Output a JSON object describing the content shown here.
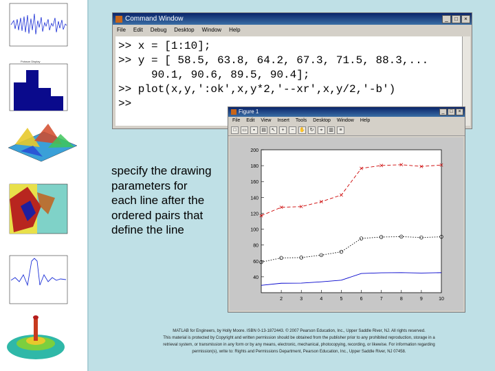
{
  "command_window": {
    "title": "Command Window",
    "menu": [
      "File",
      "Edit",
      "Debug",
      "Desktop",
      "Window",
      "Help"
    ],
    "lines": [
      ">> x = [1:10];",
      ">> y = [ 58.5, 63.8, 64.2, 67.3, 71.5, 88.3,...",
      "     90.1, 90.6, 89.5, 90.4];",
      ">> plot(x,y,':ok',x,y*2,'--xr',x,y/2,'-b')",
      ">>"
    ]
  },
  "figure_window": {
    "title": "Figure 1",
    "menu": [
      "File",
      "Edit",
      "View",
      "Insert",
      "Tools",
      "Desktop",
      "Window",
      "Help"
    ],
    "toolbar_icons": [
      "new-icon",
      "open-icon",
      "save-icon",
      "print-icon",
      "pointer-icon",
      "zoom-in-icon",
      "zoom-out-icon",
      "pan-icon",
      "rotate-icon",
      "datacursor-icon",
      "colorbar-icon",
      "legend-icon"
    ]
  },
  "chart_data": {
    "type": "line",
    "x": [
      1,
      2,
      3,
      4,
      5,
      6,
      7,
      8,
      9,
      10
    ],
    "series": [
      {
        "style": ":ok",
        "values": [
          58.5,
          63.8,
          64.2,
          67.3,
          71.5,
          88.3,
          90.1,
          90.6,
          89.5,
          90.4
        ],
        "color": "#000000"
      },
      {
        "style": "--xr",
        "values": [
          117.0,
          127.6,
          128.4,
          134.6,
          143.0,
          176.6,
          180.2,
          181.2,
          179.0,
          180.8
        ],
        "color": "#cc0000"
      },
      {
        "style": "-b",
        "values": [
          29.25,
          31.9,
          32.1,
          33.65,
          35.75,
          44.15,
          45.05,
          45.3,
          44.75,
          45.2
        ],
        "color": "#0000cc"
      }
    ],
    "xlim": [
      1,
      10
    ],
    "ylim": [
      20,
      200
    ],
    "x_ticks": [
      "2",
      "3",
      "4",
      "5",
      "6",
      "7",
      "8",
      "9",
      "10"
    ],
    "y_ticks": [
      "40",
      "60",
      "80",
      "100",
      "120",
      "140",
      "160",
      "180",
      "200"
    ],
    "grid": false
  },
  "caption": "specify the drawing parameters for each line after the ordered pairs that define the line",
  "footer": {
    "line1": "MATLAB for Engineers, by Holly Moore. ISBN 0-13-1872443. © 2007 Pearson Education, Inc., Upper Saddle River, NJ. All rights reserved.",
    "line2": "This material is protected by Copyright and written permission should be obtained from the publisher prior to any prohibited reproduction, storage in a",
    "line3": "retrieval system, or transmission in any form or by any means, electronic, mechanical, photocopying, recording, or likewise. For information regarding",
    "line4": "permission(s), write to: Rights and Permissions Department, Pearson Education, Inc., Upper Saddle River, NJ 07458."
  },
  "left_thumbnails": {
    "histogram_title": "Poisson Display"
  }
}
